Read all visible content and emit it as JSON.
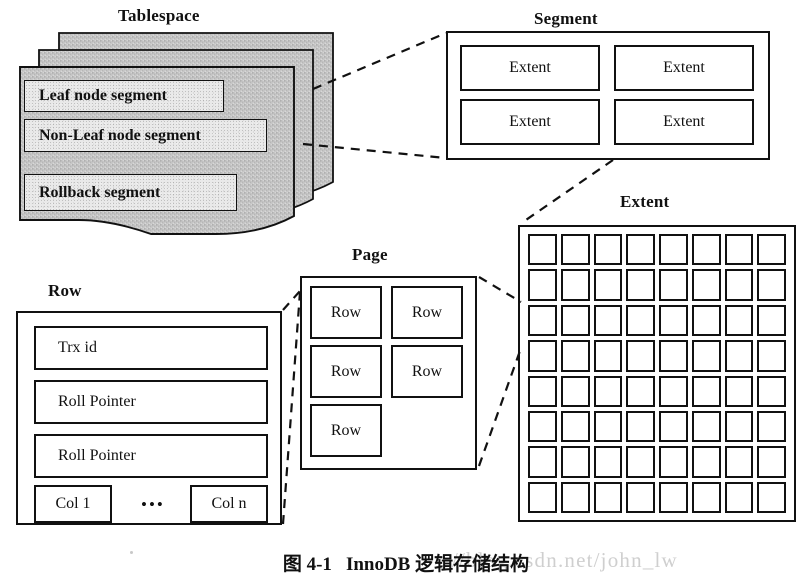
{
  "figure": {
    "caption_number": "图 4-1",
    "caption_title": "InnoDB 逻辑存储结构",
    "watermark": "//blog.csdn.net/john_lw",
    "background_color": "#ffffff",
    "ink_color": "#111111",
    "sheet_fill": "#c9c9c9",
    "segment_band_fill": "#e9e9e9"
  },
  "tablespace": {
    "label": "Tablespace",
    "sheet_count": 3,
    "segments": [
      {
        "label": "Leaf node segment"
      },
      {
        "label": "Non-Leaf node segment"
      },
      {
        "label": "Rollback segment"
      }
    ]
  },
  "segment": {
    "label": "Segment",
    "extents": [
      {
        "label": "Extent"
      },
      {
        "label": "Extent"
      },
      {
        "label": "Extent"
      },
      {
        "label": "Extent"
      }
    ]
  },
  "extent": {
    "label": "Extent",
    "grid_rows": 8,
    "grid_cols": 8,
    "page_count": 64,
    "cell_label": ""
  },
  "page": {
    "label": "Page",
    "rows": [
      {
        "label": "Row"
      },
      {
        "label": "Row"
      },
      {
        "label": "Row"
      },
      {
        "label": "Row"
      },
      {
        "label": "Row"
      }
    ]
  },
  "row": {
    "label": "Row",
    "fields": [
      {
        "label": "Trx id"
      },
      {
        "label": "Roll Pointer"
      },
      {
        "label": "Roll Pointer"
      }
    ],
    "columns": {
      "first": "Col 1",
      "ellipsis": "•••",
      "last": "Col n"
    }
  },
  "connectors": [
    {
      "from": "tablespace",
      "to": "segment"
    },
    {
      "from": "segment",
      "to": "extent"
    },
    {
      "from": "extent",
      "to": "page"
    },
    {
      "from": "page",
      "to": "row"
    }
  ]
}
